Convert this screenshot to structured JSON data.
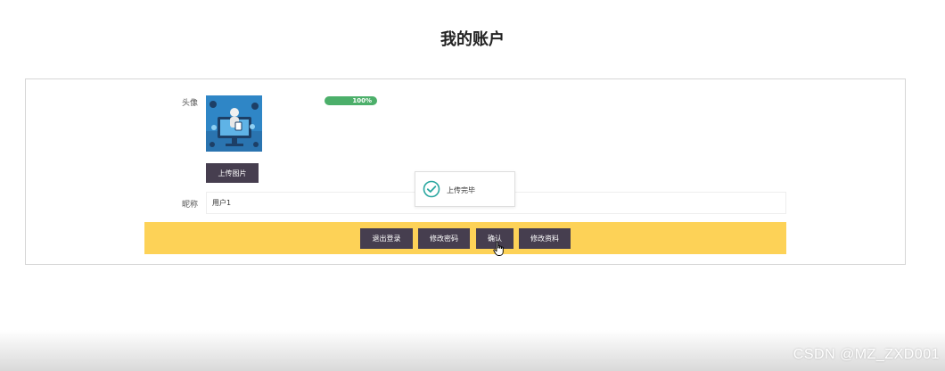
{
  "page": {
    "title": "我的账户"
  },
  "form": {
    "avatar_label": "头像",
    "nickname_label": "昵称",
    "nickname_value": "用户1",
    "upload_progress_text": "100%",
    "upload_progress": 1.0,
    "upload_button": "上传图片"
  },
  "toast": {
    "message": "上传完毕",
    "icon": "check-circle-icon"
  },
  "actions": {
    "logout": "退出登录",
    "change_password": "修改密码",
    "confirm": "确认",
    "edit_profile": "修改资料"
  },
  "watermark": {
    "text": "CSDN @MZ_ZXD001"
  },
  "colors": {
    "button_bg": "#463e4f",
    "action_bar_bg": "#fdd257",
    "progress_bar": "#4caf6a",
    "toast_icon": "#2aa7a0"
  }
}
